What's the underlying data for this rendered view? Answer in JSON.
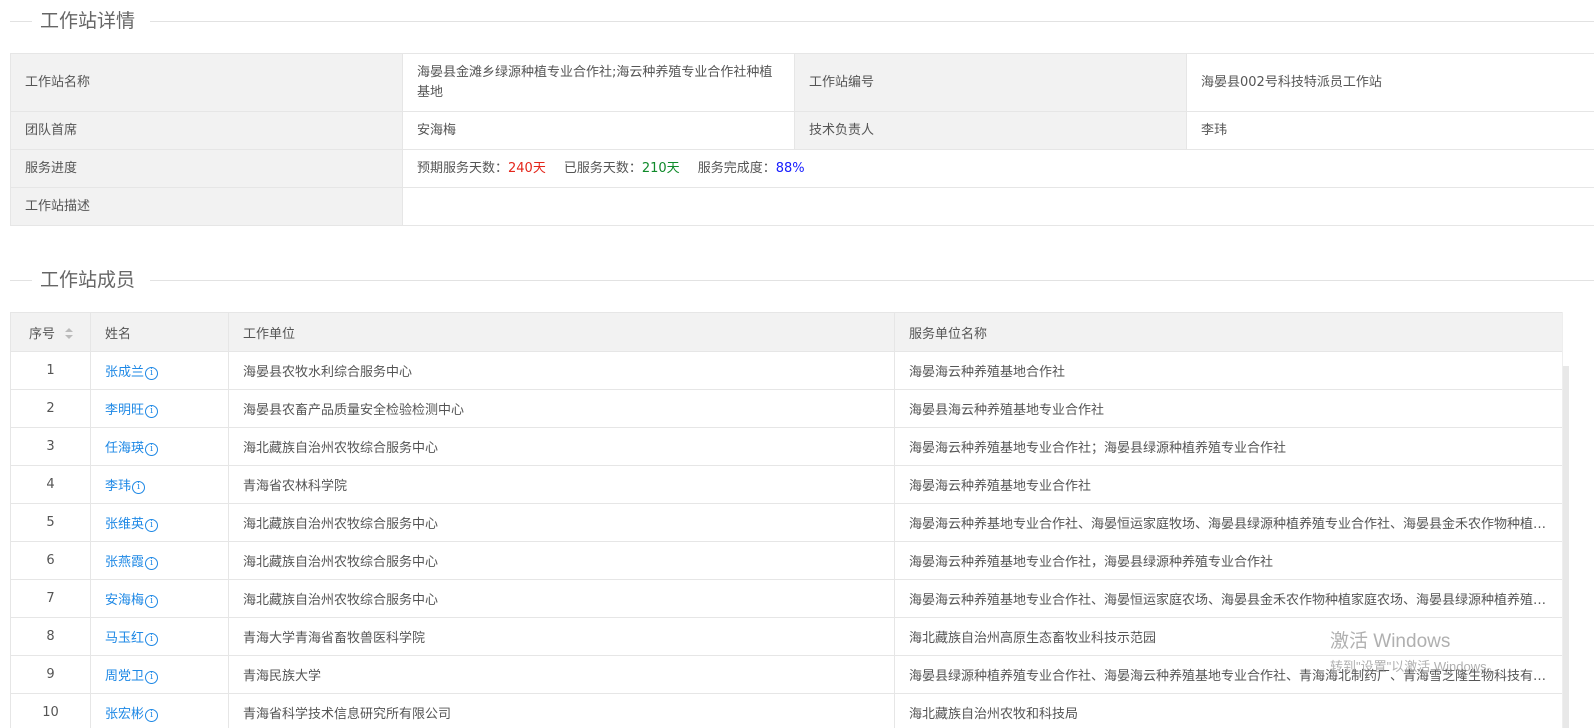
{
  "detail_section": {
    "title": "工作站详情",
    "station_name_label": "工作站名称",
    "station_name_value": "海晏县金滩乡绿源种植专业合作社;海云种养殖专业合作社种植基地",
    "station_code_label": "工作站编号",
    "station_code_value": "海晏县002号科技特派员工作站",
    "team_lead_label": "团队首席",
    "team_lead_value": "安海梅",
    "tech_lead_label": "技术负责人",
    "tech_lead_value": "李玮",
    "progress_label": "服务进度",
    "expected_days_label": "预期服务天数：",
    "expected_days_value": "240天",
    "served_days_label": "已服务天数：",
    "served_days_value": "210天",
    "completion_label": "服务完成度：",
    "completion_value": "88%",
    "description_label": "工作站描述",
    "description_value": "",
    "colors": {
      "red": "#e4261b",
      "green": "#0f8a2a",
      "blue": "#1a20ff"
    }
  },
  "members_section": {
    "title": "工作站成员",
    "columns": {
      "seq": "序号",
      "name": "姓名",
      "unit": "工作单位",
      "service": "服务单位名称"
    },
    "sort_icon": "sort-caret-icon",
    "info_icon": "info-circle-icon",
    "info_icon_glyph": "i",
    "rows": [
      {
        "seq": "1",
        "name": "张成兰",
        "unit": "海晏县农牧水利综合服务中心",
        "service": "海晏海云种养殖基地合作社"
      },
      {
        "seq": "2",
        "name": "李明旺",
        "unit": "海晏县农畜产品质量安全检验检测中心",
        "service": "海晏县海云种养殖基地专业合作社"
      },
      {
        "seq": "3",
        "name": "任海瑛",
        "unit": "海北藏族自治州农牧综合服务中心",
        "service": "海晏海云种养殖基地专业合作社；海晏县绿源种植养殖专业合作社"
      },
      {
        "seq": "4",
        "name": "李玮",
        "unit": "青海省农林科学院",
        "service": "海晏海云种养殖基地专业合作社"
      },
      {
        "seq": "5",
        "name": "张维英",
        "unit": "海北藏族自治州农牧综合服务中心",
        "service": "海晏海云种养基地专业合作社、海晏恒运家庭牧场、海晏县绿源种植养殖专业合作社、海晏县金禾农作物种植家庭农场"
      },
      {
        "seq": "6",
        "name": "张燕霞",
        "unit": "海北藏族自治州农牧综合服务中心",
        "service": "海晏海云种养殖基地专业合作社，海晏县绿源种养殖专业合作社"
      },
      {
        "seq": "7",
        "name": "安海梅",
        "unit": "海北藏族自治州农牧综合服务中心",
        "service": "海晏海云种养殖基地专业合作社、海晏恒运家庭农场、海晏县金禾农作物种植家庭农场、海晏县绿源种植养殖专业合作社"
      },
      {
        "seq": "8",
        "name": "马玉红",
        "unit": "青海大学青海省畜牧兽医科学院",
        "service": "海北藏族自治州高原生态畜牧业科技示范园"
      },
      {
        "seq": "9",
        "name": "周党卫",
        "unit": "青海民族大学",
        "service": "海晏县绿源种植养殖专业合作社、海晏海云种养殖基地专业合作社、青海海北制药厂、青海雪芝隆生物科技有限公司"
      },
      {
        "seq": "10",
        "name": "张宏彬",
        "unit": "青海省科学技术信息研究所有限公司",
        "service": "海北藏族自治州农牧和科技局"
      }
    ]
  },
  "watermark": {
    "line1": "激活 Windows",
    "line2": "转到\"设置\"以激活 Windows。"
  }
}
